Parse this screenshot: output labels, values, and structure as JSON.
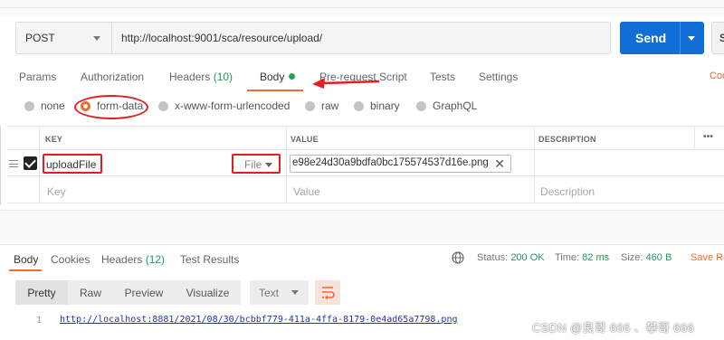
{
  "request": {
    "method": "POST",
    "url": "http://localhost:9001/sca/resource/upload/",
    "send_label": "Send",
    "save_label": "S"
  },
  "tabs": {
    "params": "Params",
    "authorization": "Authorization",
    "headers_label": "Headers",
    "headers_count": "(10)",
    "body": "Body",
    "prerequest": "Pre-request Script",
    "tests": "Tests",
    "settings": "Settings",
    "cookies": "Coo"
  },
  "body_types": {
    "none": "none",
    "form_data": "form-data",
    "urlencoded": "x-www-form-urlencoded",
    "raw": "raw",
    "binary": "binary",
    "graphql": "GraphQL",
    "selected": "form-data"
  },
  "table": {
    "headers": {
      "key": "KEY",
      "value": "VALUE",
      "description": "DESCRIPTION",
      "more": "•••"
    },
    "rows": [
      {
        "key": "uploadFile",
        "type": "File",
        "value": "e98e24d30a9bdfa0bc175574537d16e.png",
        "remove": "✕"
      }
    ],
    "placeholders": {
      "key": "Key",
      "value": "Value",
      "description": "Description"
    }
  },
  "response": {
    "tabs": {
      "body": "Body",
      "cookies": "Cookies",
      "headers_label": "Headers",
      "headers_count": "(12)",
      "test_results": "Test Results"
    },
    "status_label": "Status:",
    "status_value": "200 OK",
    "time_label": "Time:",
    "time_value": "82 ms",
    "size_label": "Size:",
    "size_value": "460 B",
    "save_label": "Save Re",
    "views": {
      "pretty": "Pretty",
      "raw": "Raw",
      "preview": "Preview",
      "visualize": "Visualize"
    },
    "format": "Text",
    "line_number": "1",
    "line": "http://localhost:8881/2021/08/30/bcbbf779-411a-4ffa-8179-0e4ad65a7798.png"
  },
  "watermark": "CSDN @良哥 666 、攀哥 666",
  "colors": {
    "accent": "#f06b30",
    "send": "#0f6fd6",
    "status_green": "#1f9c55",
    "annotation_red": "#e02020",
    "link_blue": "#1a33b8"
  }
}
